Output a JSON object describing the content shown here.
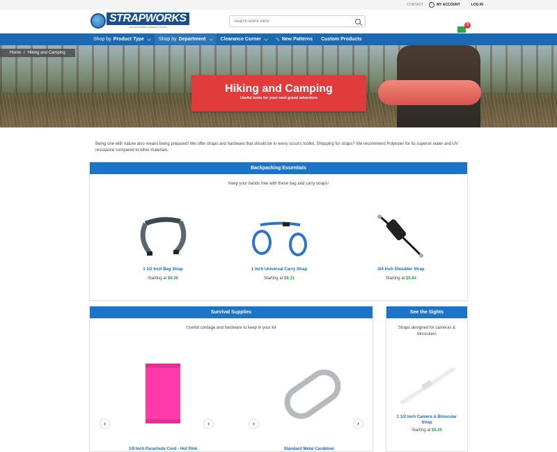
{
  "topbar": {
    "contact": "CONTACT",
    "account": "MY ACCOUNT",
    "login": "LOG IN"
  },
  "header": {
    "brand": "STRAPWORKS",
    "tagline": "THE WORLDWIDE LEADER IN STRAPS",
    "search_placeholder": "Search entire store",
    "cart_count": "0"
  },
  "nav": [
    {
      "pre": "Shop by",
      "label": "Product Type"
    },
    {
      "pre": "Shop by",
      "label": "Department"
    },
    {
      "pre": "",
      "label": "Clearance Corner"
    },
    {
      "pre": "",
      "label": "New Patterns"
    },
    {
      "pre": "",
      "label": "Custom Products"
    }
  ],
  "breadcrumb": {
    "home": "Home",
    "sep": "/",
    "current": "Hiking and Camping"
  },
  "banner": {
    "title": "Hiking and Camping",
    "subtitle": "Useful tools for your next grand adventure"
  },
  "intro": "Being one with nature also means being prepared! We offer straps and hardware that should be in every scout's toolkit. Shopping for straps? We recommend Polyester for its superior water and UV resistance compared to other materials.",
  "backpacking": {
    "title": "Backpacking Essentials",
    "subtitle": "Keep your hands free with these bag and carry straps!",
    "products": [
      {
        "name": "1 1/2 Inch Bag Strap",
        "price_label": "Starting at",
        "price": "$6.36"
      },
      {
        "name": "1 Inch Universal Carry Strap",
        "price_label": "Starting at",
        "price": "$8.31"
      },
      {
        "name": "3/4 Inch Shoulder Strap",
        "price_label": "Starting at",
        "price": "$5.84"
      }
    ]
  },
  "survival": {
    "title": "Survival Supplies",
    "subtitle": "Usefull cordage and hardware to keep in your kit",
    "products": [
      {
        "name": "1/8 Inch Parachute Cord - Hot Pink"
      },
      {
        "name": "Standard Metal Carabiner"
      }
    ]
  },
  "sights": {
    "title": "See the Sights",
    "subtitle": "Straps designed for cameras & binoculars",
    "products": [
      {
        "name": "1 1/2 Inch Camera & Binocular Strap",
        "price_label": "Starting at",
        "price": "$8.20"
      }
    ]
  },
  "colors": {
    "nav": "#1b68b5",
    "panel_header": "#1b74c5",
    "banner": "#e23b3b",
    "price": "#2ca745"
  }
}
